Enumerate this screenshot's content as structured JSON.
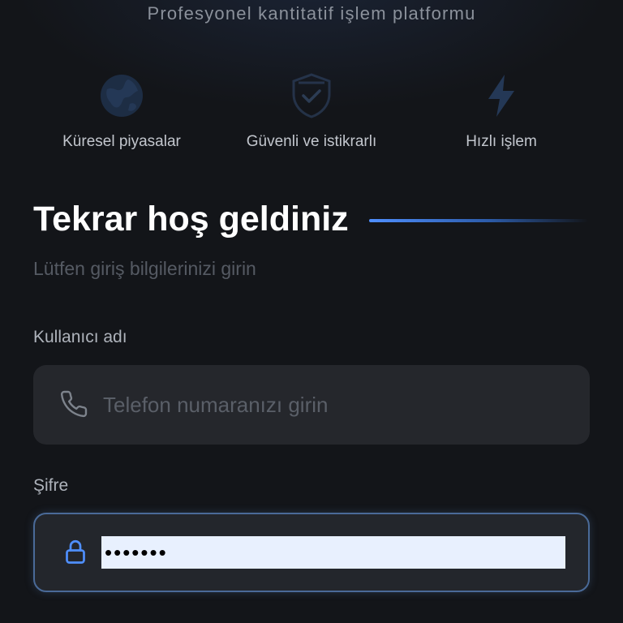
{
  "header": {
    "tagline": "Profesyonel kantitatif işlem platformu"
  },
  "features": [
    {
      "label": "Küresel piyasalar",
      "icon": "globe-icon"
    },
    {
      "label": "Güvenli ve istikrarlı",
      "icon": "shield-check-icon"
    },
    {
      "label": "Hızlı işlem",
      "icon": "lightning-icon"
    }
  ],
  "login": {
    "title": "Tekrar hoş geldiniz",
    "subtitle": "Lütfen giriş bilgilerinizi girin",
    "username": {
      "label": "Kullanıcı adı",
      "placeholder": "Telefon numaranızı girin",
      "value": "",
      "icon": "phone-icon"
    },
    "password": {
      "label": "Şifre",
      "value": "•••••••",
      "icon": "lock-icon"
    }
  },
  "colors": {
    "background": "#131519",
    "accent": "#4f8fff",
    "input_background": "#25272c",
    "focus_border": "#4a6a98",
    "autofill_background": "#e8f0fe"
  }
}
